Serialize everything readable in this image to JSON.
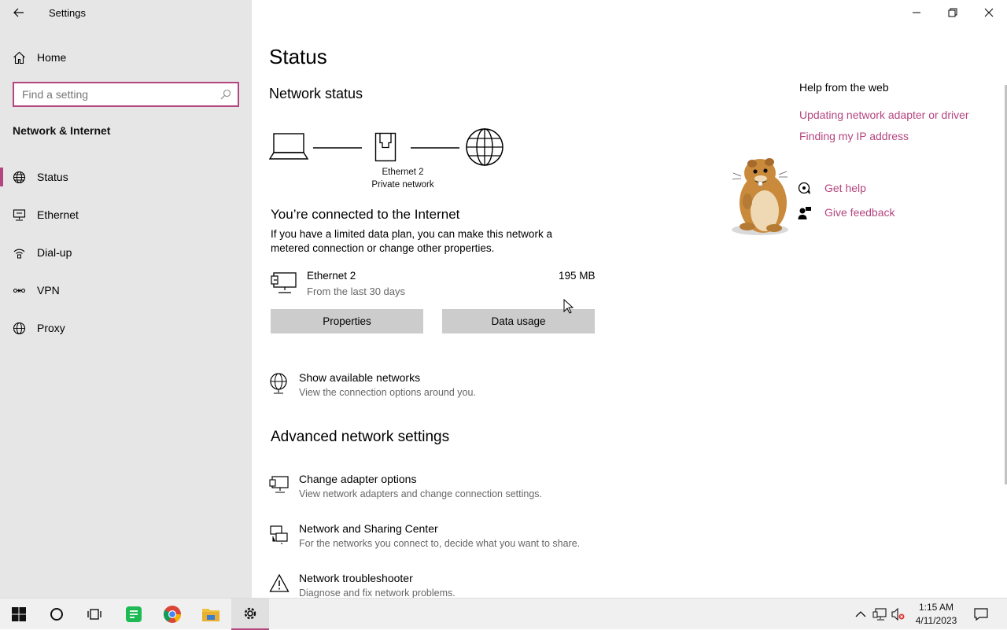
{
  "window": {
    "app_title": "Settings",
    "back_icon": "back-arrow-icon",
    "controls": {
      "minimize_icon": "minimize-icon",
      "restore_icon": "restore-icon",
      "close_icon": "close-icon"
    }
  },
  "sidebar": {
    "home_label": "Home",
    "search_placeholder": "Find a setting",
    "section_title": "Network & Internet",
    "accent": "#b4457f",
    "items": [
      {
        "label": "Status",
        "icon": "globe-icon",
        "active": true
      },
      {
        "label": "Ethernet",
        "icon": "ethernet-icon",
        "active": false
      },
      {
        "label": "Dial-up",
        "icon": "dialup-icon",
        "active": false
      },
      {
        "label": "VPN",
        "icon": "vpn-icon",
        "active": false
      },
      {
        "label": "Proxy",
        "icon": "globe-icon",
        "active": false
      }
    ]
  },
  "main": {
    "page_title": "Status",
    "network_status_title": "Network status",
    "diagram": {
      "adapter": "Ethernet 2",
      "network": "Private network"
    },
    "connected_title": "You’re connected to the Internet",
    "connected_desc": "If you have a limited data plan, you can make this network a metered connection or change other properties.",
    "connection": {
      "name": "Ethernet 2",
      "subtitle": "From the last 30 days",
      "usage": "195 MB"
    },
    "buttons": {
      "properties": "Properties",
      "data_usage": "Data usage"
    },
    "show_networks": {
      "title": "Show available networks",
      "desc": "View the connection options around you."
    },
    "advanced_title": "Advanced network settings",
    "advanced": [
      {
        "title": "Change adapter options",
        "desc": "View network adapters and change connection settings.",
        "icon": "adapter-icon"
      },
      {
        "title": "Network and Sharing Center",
        "desc": "For the networks you connect to, decide what you want to share.",
        "icon": "sharing-icon"
      },
      {
        "title": "Network troubleshooter",
        "desc": "Diagnose and fix network problems.",
        "icon": "warning-icon"
      }
    ]
  },
  "help": {
    "title": "Help from the web",
    "links": [
      "Updating network adapter or driver",
      "Finding my IP address"
    ],
    "get_help": "Get help",
    "give_feedback": "Give feedback"
  },
  "taskbar": {
    "time": "1:15 AM",
    "date": "4/11/2023",
    "apps": [
      "start-icon",
      "cortana-icon",
      "task-view-icon",
      "notes-app-icon",
      "chrome-icon",
      "file-explorer-icon",
      "settings-icon"
    ]
  }
}
